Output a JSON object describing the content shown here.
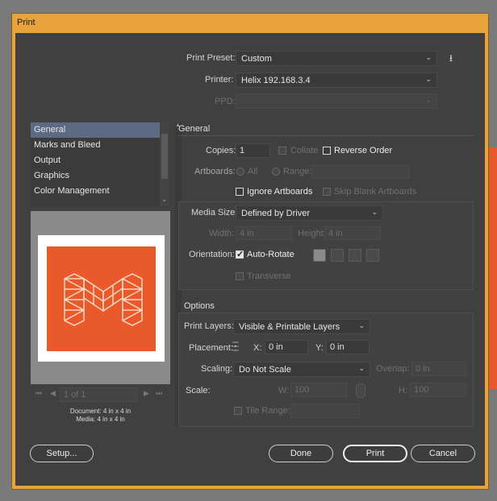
{
  "window": {
    "title": "Print"
  },
  "top": {
    "preset_label": "Print Preset:",
    "preset_value": "Custom",
    "printer_label": "Printer:",
    "printer_value": "Helix 192.168.3.4",
    "ppd_label": "PPD:"
  },
  "sidebar": {
    "items": [
      {
        "label": "General",
        "selected": true
      },
      {
        "label": "Marks and Bleed"
      },
      {
        "label": "Output"
      },
      {
        "label": "Graphics"
      },
      {
        "label": "Color Management"
      }
    ],
    "page_nav": "1 of 1",
    "document_label": "Document:",
    "document_value": "4 in x 4 in",
    "media_label": "Media:",
    "media_value": "4 in x 4 in"
  },
  "general": {
    "section_title": "General",
    "copies_label": "Copies:",
    "copies_value": "1",
    "collate_label": "Collate",
    "reverse_label": "Reverse Order",
    "artboards_label": "Artboards:",
    "all_label": "All",
    "range_label": "Range:",
    "ignore_label": "Ignore Artboards",
    "skip_label": "Skip Blank Artboards",
    "media_size_label": "Media Size:",
    "media_size_value": "Defined by Driver",
    "width_label": "Width:",
    "width_value": "4 in",
    "height_label": "Height:",
    "height_value": "4 in",
    "orientation_label": "Orientation:",
    "autorotate_label": "Auto-Rotate",
    "transverse_label": "Transverse"
  },
  "options": {
    "section_title": "Options",
    "layers_label": "Print Layers:",
    "layers_value": "Visible & Printable Layers",
    "placement_label": "Placement:",
    "x_label": "X:",
    "x_value": "0 in",
    "y_label": "Y:",
    "y_value": "0 in",
    "scaling_label": "Scaling:",
    "scaling_value": "Do Not Scale",
    "overlap_label": "Overlap:",
    "overlap_value": "0 in",
    "scale_label": "Scale:",
    "w_label": "W:",
    "w_value": "100",
    "h_label": "H:",
    "h_value": "100",
    "tile_label": "Tile Range:"
  },
  "buttons": {
    "setup": "Setup...",
    "done": "Done",
    "print": "Print",
    "cancel": "Cancel"
  },
  "colors": {
    "accent": "#e9592a",
    "frame": "#e8a33c",
    "panel": "#404040"
  }
}
